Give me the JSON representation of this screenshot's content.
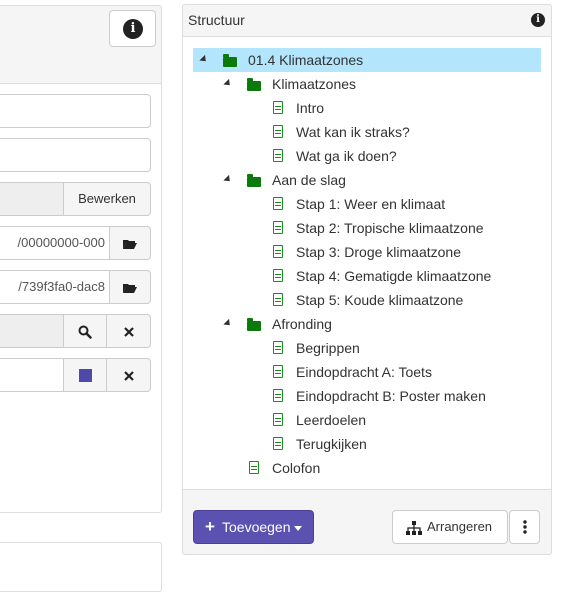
{
  "left_form": {
    "edit_button": "Bewerken",
    "path_field_1": "/00000000-000",
    "path_field_2": "/739f3fa0-dac8",
    "search_icon": "search-icon",
    "clear_icon": "close-icon",
    "color_swatch": "#4f4aa8"
  },
  "structure": {
    "title": "Structuur",
    "info_icon": "info-icon",
    "tree": [
      {
        "label": "01.4 Klimaatzones",
        "type": "folder",
        "level": 0,
        "expanded": true,
        "selected": true
      },
      {
        "label": "Klimaatzones",
        "type": "folder",
        "level": 1,
        "expanded": true
      },
      {
        "label": "Intro",
        "type": "page",
        "level": 2
      },
      {
        "label": "Wat kan ik straks?",
        "type": "page",
        "level": 2
      },
      {
        "label": "Wat ga ik doen?",
        "type": "page",
        "level": 2
      },
      {
        "label": "Aan de slag",
        "type": "folder",
        "level": 1,
        "expanded": true
      },
      {
        "label": "Stap 1: Weer en klimaat",
        "type": "page",
        "level": 2
      },
      {
        "label": "Stap 2: Tropische klimaatzone",
        "type": "page",
        "level": 2
      },
      {
        "label": "Stap 3: Droge klimaatzone",
        "type": "page",
        "level": 2
      },
      {
        "label": "Stap 4: Gematigde klimaatzone",
        "type": "page",
        "level": 2
      },
      {
        "label": "Stap 5: Koude klimaatzone",
        "type": "page",
        "level": 2
      },
      {
        "label": "Afronding",
        "type": "folder",
        "level": 1,
        "expanded": true
      },
      {
        "label": "Begrippen",
        "type": "page",
        "level": 2
      },
      {
        "label": "Eindopdracht A: Toets",
        "type": "page",
        "level": 2
      },
      {
        "label": "Eindopdracht B: Poster maken",
        "type": "page",
        "level": 2
      },
      {
        "label": "Leerdoelen",
        "type": "page",
        "level": 2
      },
      {
        "label": "Terugkijken",
        "type": "page",
        "level": 2
      },
      {
        "label": "Colofon",
        "type": "page",
        "level": 1
      }
    ],
    "add_button": "Toevoegen",
    "arrange_button": "Arrangeren"
  },
  "colors": {
    "primary": "#5b51b0",
    "selected_row": "#b3e5fc",
    "tree_icon_green": "#0a7a0a"
  }
}
